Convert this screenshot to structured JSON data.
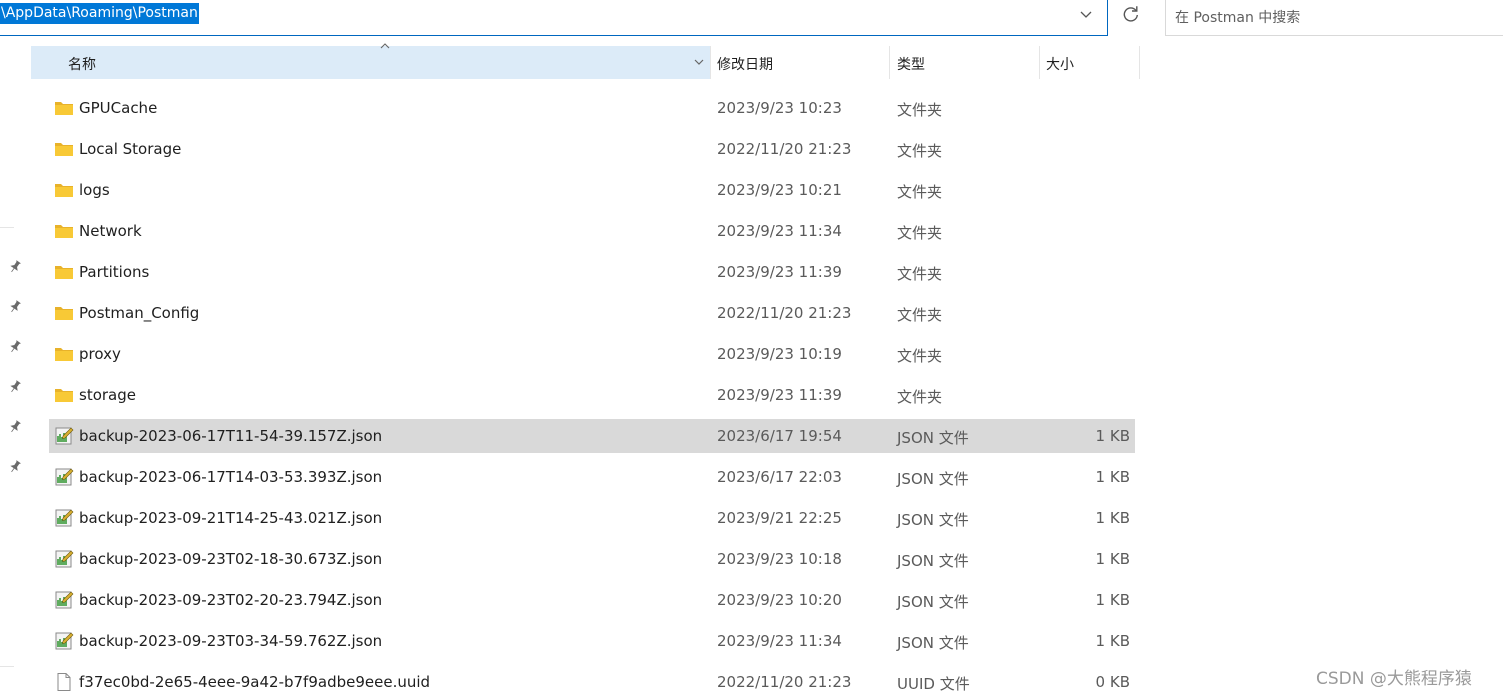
{
  "address": {
    "path": "\\AppData\\Roaming\\Postman",
    "dropdown_icon": "chevron-down-icon",
    "refresh_icon": "refresh-icon"
  },
  "search": {
    "placeholder": "在 Postman 中搜索"
  },
  "columns": {
    "name": "名称",
    "date": "修改日期",
    "type": "类型",
    "size": "大小"
  },
  "files": [
    {
      "name": "GPUCache",
      "date": "2023/9/23 10:23",
      "type": "文件夹",
      "size": "",
      "icon": "folder-icon"
    },
    {
      "name": "Local Storage",
      "date": "2022/11/20 21:23",
      "type": "文件夹",
      "size": "",
      "icon": "folder-icon"
    },
    {
      "name": "logs",
      "date": "2023/9/23 10:21",
      "type": "文件夹",
      "size": "",
      "icon": "folder-icon"
    },
    {
      "name": "Network",
      "date": "2023/9/23 11:34",
      "type": "文件夹",
      "size": "",
      "icon": "folder-icon"
    },
    {
      "name": "Partitions",
      "date": "2023/9/23 11:39",
      "type": "文件夹",
      "size": "",
      "icon": "folder-icon"
    },
    {
      "name": "Postman_Config",
      "date": "2022/11/20 21:23",
      "type": "文件夹",
      "size": "",
      "icon": "folder-icon"
    },
    {
      "name": "proxy",
      "date": "2023/9/23 10:19",
      "type": "文件夹",
      "size": "",
      "icon": "folder-icon"
    },
    {
      "name": "storage",
      "date": "2023/9/23 11:39",
      "type": "文件夹",
      "size": "",
      "icon": "folder-icon"
    },
    {
      "name": "backup-2023-06-17T11-54-39.157Z.json",
      "date": "2023/6/17 19:54",
      "type": "JSON 文件",
      "size": "1 KB",
      "icon": "json-file-icon",
      "selected": true
    },
    {
      "name": "backup-2023-06-17T14-03-53.393Z.json",
      "date": "2023/6/17 22:03",
      "type": "JSON 文件",
      "size": "1 KB",
      "icon": "json-file-icon"
    },
    {
      "name": "backup-2023-09-21T14-25-43.021Z.json",
      "date": "2023/9/21 22:25",
      "type": "JSON 文件",
      "size": "1 KB",
      "icon": "json-file-icon"
    },
    {
      "name": "backup-2023-09-23T02-18-30.673Z.json",
      "date": "2023/9/23 10:18",
      "type": "JSON 文件",
      "size": "1 KB",
      "icon": "json-file-icon"
    },
    {
      "name": "backup-2023-09-23T02-20-23.794Z.json",
      "date": "2023/9/23 10:20",
      "type": "JSON 文件",
      "size": "1 KB",
      "icon": "json-file-icon"
    },
    {
      "name": "backup-2023-09-23T03-34-59.762Z.json",
      "date": "2023/9/23 11:34",
      "type": "JSON 文件",
      "size": "1 KB",
      "icon": "json-file-icon"
    },
    {
      "name": "f37ec0bd-2e65-4eee-9a42-b7f9adbe9eee.uuid",
      "date": "2022/11/20 21:23",
      "type": "UUID 文件",
      "size": "0 KB",
      "icon": "blank-file-icon"
    }
  ],
  "nav_pins": [
    "pin-icon",
    "pin-icon",
    "pin-icon",
    "pin-icon",
    "pin-icon",
    "pin-icon"
  ],
  "watermark": "CSDN @大熊程序猿",
  "colors": {
    "selection": "#0078d7",
    "header_hover": "#dcebf8",
    "row_selected": "#d9d9d9",
    "folder": "#f8c936"
  }
}
